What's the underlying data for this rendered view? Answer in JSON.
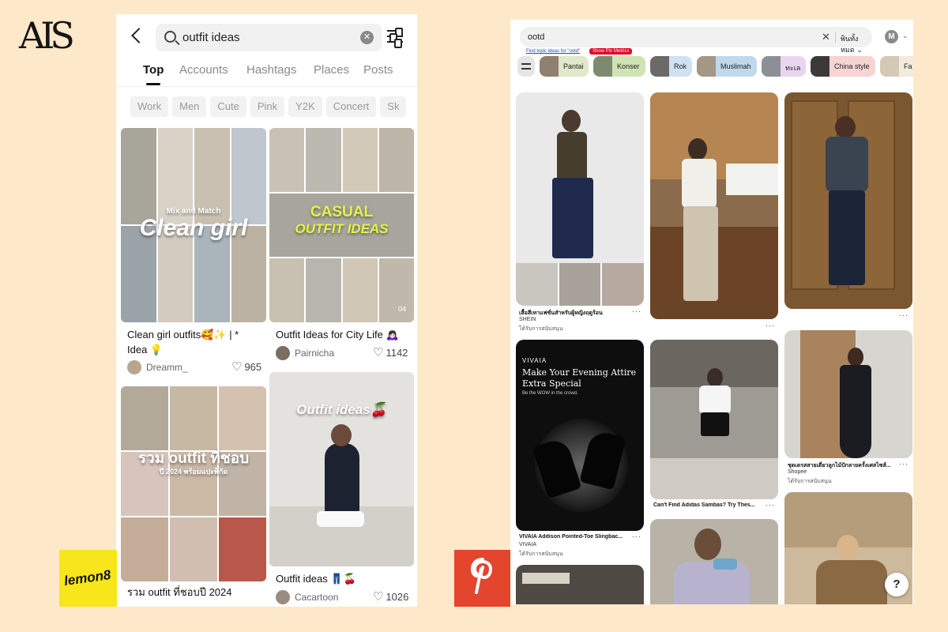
{
  "brand": "AIS",
  "lemon8": {
    "search": {
      "value": "outfit ideas"
    },
    "tabs": [
      "Top",
      "Accounts",
      "Hashtags",
      "Places",
      "Posts"
    ],
    "chips": [
      "Work",
      "Men",
      "Cute",
      "Pink",
      "Y2K",
      "Concert",
      "Sk"
    ],
    "cards": [
      {
        "overlay_small": "Mix and Match",
        "overlay": "Clean girl",
        "title": "Clean girl outfits🥰✨ | * Idea 💡",
        "author": "Dreamm_",
        "likes": "965"
      },
      {
        "overlay_small": "CASUAL",
        "overlay": "OUTFIT IDEAS",
        "title": "Outfit Ideas for City Life 🙇🏻‍♀️",
        "author": "Pairnicha",
        "likes": "1142",
        "page_indicator": "04"
      },
      {
        "overlay": "รวม outfit ที่ชอบ",
        "overlay_small": "ปี 2024 พร้อมแปะพิกัด",
        "title": "รวม outfit ที่ชอบปี 2024"
      },
      {
        "overlay": "Outfit ideas🍒",
        "title": "Outfit ideas 👖🍒",
        "author": "Cacartoon",
        "likes": "1026"
      }
    ],
    "logo_text": "lemon8"
  },
  "pinterest": {
    "search": {
      "value": "ootd",
      "scope": "พินทั้งหมด"
    },
    "avatar_letter": "M",
    "topic_link": "Find topic ideas for \"ootd\"",
    "metrics_label": "Show Pin Metrics",
    "chips": [
      "Pantai",
      "Konser",
      "Rok",
      "Muslimah",
      "ทะเล",
      "China style",
      "Fa"
    ],
    "pins": [
      {
        "title": "เสื้อสีเทาแฟชั่นสำหรับผู้หญิงฤดูร้อน",
        "source": "SHEIN",
        "sponsored": "ได้รับการสนับสนุน"
      },
      {
        "brand": "VIVAIA",
        "headline": "Make Your Evening Attire Extra Special",
        "tagline": "Be the WOW in the crowd.",
        "title": "VIVAIA Addison Pointed-Toe Slingbac...",
        "source": "VIVAIA",
        "sponsored": "ได้รับการสนับสนุน"
      },
      {
        "title": "Can't Find Adidas Sambas? Try Thes..."
      },
      {
        "title": "ชุดเดรสสายเดี่ยวลูกไม้ปักลายครั้งเศสไซส์...",
        "source": "Shopee",
        "sponsored": "ได้รับการสนับสนุน"
      }
    ],
    "help": "?"
  },
  "colors": {
    "background": "#fde9c9",
    "lemon8_yellow": "#f7e61c",
    "pinterest_red": "#e4452d",
    "metrics_red": "#e60023"
  }
}
